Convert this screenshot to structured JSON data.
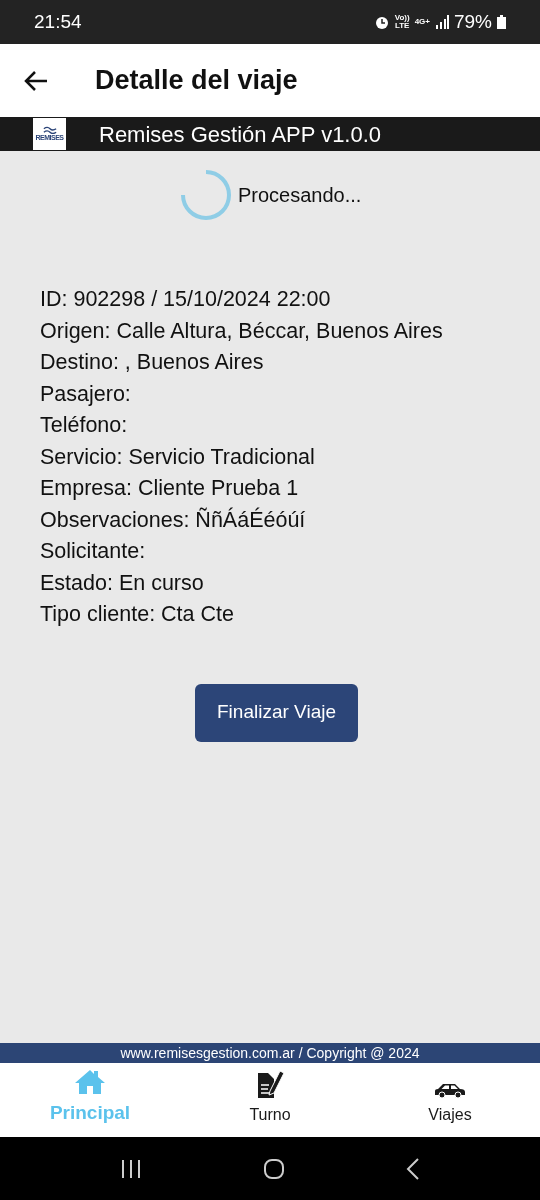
{
  "status_bar": {
    "time": "21:54",
    "volte": "Vo))",
    "lte": "LTE",
    "network": "4G+",
    "battery": "79%"
  },
  "app_bar": {
    "title": "Detalle del viaje"
  },
  "brand_bar": {
    "logo_text": "REMISES",
    "title": "Remises Gestión APP v1.0.0"
  },
  "loading": {
    "text": "Procesando..."
  },
  "details": [
    "ID: 902298 / 15/10/2024 22:00",
    "Origen: Calle Altura, Béccar, Buenos Aires",
    "Destino: , Buenos Aires",
    "Pasajero:",
    "Teléfono:",
    "Servicio: Servicio Tradicional",
    "Empresa: Cliente Prueba 1",
    "Observaciones: ÑñÁáÉéóúí",
    "Solicitante:",
    "Estado: En curso",
    "Tipo cliente: Cta Cte"
  ],
  "action_button": "Finalizar Viaje",
  "footer": "www.remisesgestion.com.ar / Copyright @ 2024",
  "bottom_nav": [
    {
      "label": "Principal",
      "kind": "home",
      "selected": true
    },
    {
      "label": "Turno",
      "kind": "note",
      "selected": false
    },
    {
      "label": "Viajes",
      "kind": "car",
      "selected": false
    }
  ]
}
